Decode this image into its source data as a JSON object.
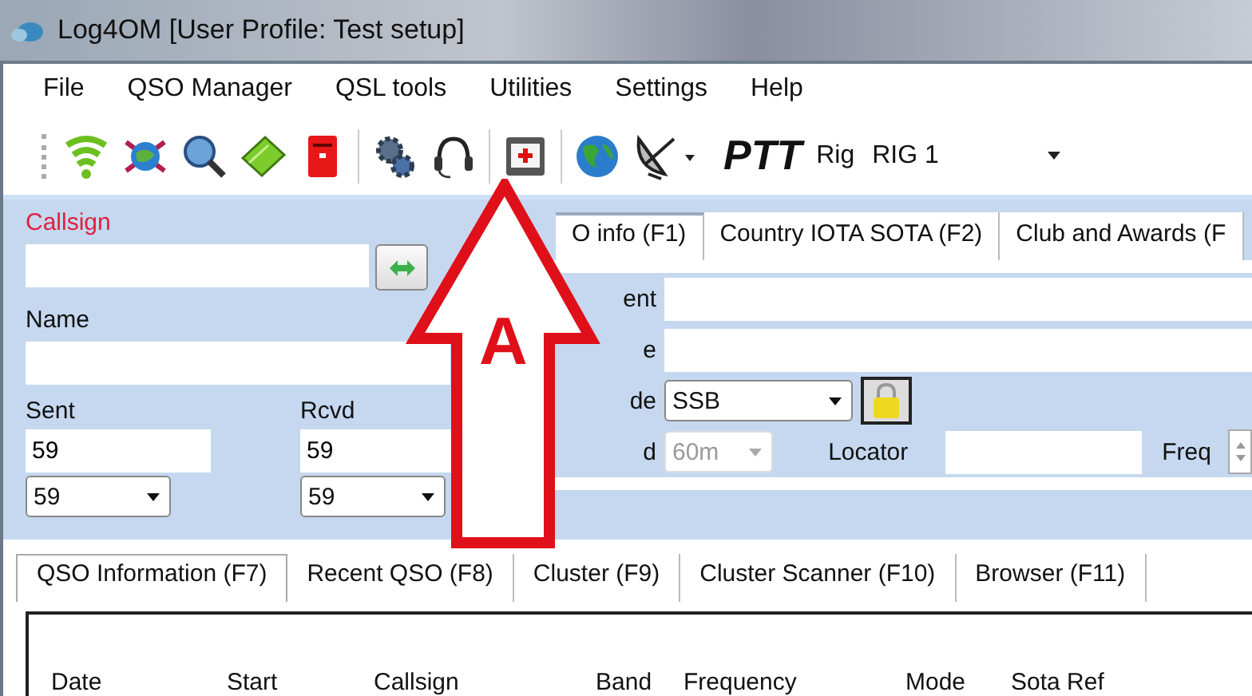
{
  "window": {
    "title": "Log4OM [User Profile: Test setup]"
  },
  "menu": [
    "File",
    "QSO Manager",
    "QSL tools",
    "Utilities",
    "Settings",
    "Help"
  ],
  "toolbar": {
    "icons": [
      {
        "kind": "wifi"
      },
      {
        "kind": "bug"
      },
      {
        "kind": "search"
      },
      {
        "kind": "book"
      },
      {
        "kind": "mailbox"
      },
      {
        "kind": "sep"
      },
      {
        "kind": "gear"
      },
      {
        "kind": "headset"
      },
      {
        "kind": "sep"
      },
      {
        "kind": "card"
      },
      {
        "kind": "sep"
      },
      {
        "kind": "globe"
      },
      {
        "kind": "dish"
      }
    ],
    "ptt": "PTT",
    "rig_label": "Rig",
    "rig_value": "RIG 1"
  },
  "callsign": {
    "label": "Callsign",
    "required": true
  },
  "name": {
    "label": "Name"
  },
  "sent": {
    "label": "Sent",
    "value": "59",
    "choice": "59"
  },
  "rcvd": {
    "label": "Rcvd",
    "value": "59",
    "choice": "59"
  },
  "info_tabs": [
    {
      "label": "O info (F1)",
      "selected": true
    },
    {
      "label": "Country IOTA SOTA (F2)",
      "selected": false
    },
    {
      "label": "Club and Awards (F",
      "selected": false
    }
  ],
  "info": {
    "row_1_label": "ent",
    "row_2_label": "e",
    "mode_label": "de",
    "mode": "SSB",
    "band_label": "d",
    "band": "60m",
    "band_disabled": true,
    "locator_label": "Locator",
    "freq_label": "Freq"
  },
  "annotation": {
    "letter": "A"
  },
  "bottom_tabs": [
    {
      "label": "QSO Information (F7)",
      "selected": true
    },
    {
      "label": "Recent QSO (F8)",
      "selected": false
    },
    {
      "label": "Cluster (F9)",
      "selected": false
    },
    {
      "label": "Cluster Scanner (F10)",
      "selected": false
    },
    {
      "label": "Browser (F11)",
      "selected": false
    }
  ],
  "table": {
    "columns": [
      "Date",
      "Start",
      "Callsign",
      "Band",
      "Frequency",
      "Mode",
      "Sota Ref"
    ]
  }
}
